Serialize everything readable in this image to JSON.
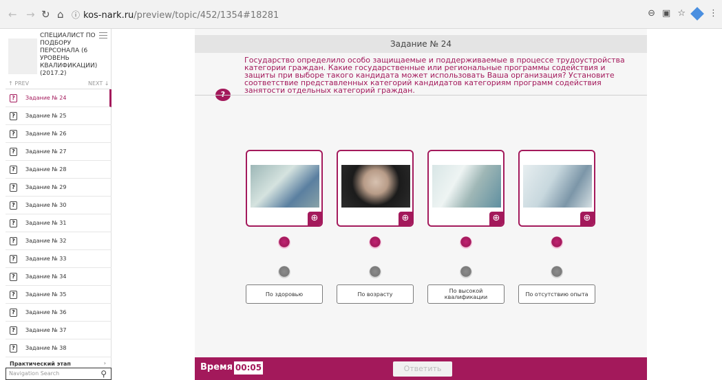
{
  "browser": {
    "url_host": "kos-nark.ru",
    "url_path": "/preview/topic/452/1354#18281"
  },
  "sidebar": {
    "course_title": "СПЕЦИАЛИСТ ПО ПОДБОРУ ПЕРСОНАЛА (6 УРОВЕНЬ КВАЛИФИКАЦИИ) (2017.2)",
    "prev_label": "↑ PREV",
    "next_label": "NEXT ↓",
    "items": [
      {
        "label": "Задание № 24"
      },
      {
        "label": "Задание № 25"
      },
      {
        "label": "Задание № 26"
      },
      {
        "label": "Задание № 27"
      },
      {
        "label": "Задание № 28"
      },
      {
        "label": "Задание № 29"
      },
      {
        "label": "Задание № 30"
      },
      {
        "label": "Задание № 31"
      },
      {
        "label": "Задание № 32"
      },
      {
        "label": "Задание № 33"
      },
      {
        "label": "Задание № 34"
      },
      {
        "label": "Задание № 35"
      },
      {
        "label": "Задание № 36"
      },
      {
        "label": "Задание № 37"
      },
      {
        "label": "Задание № 38"
      }
    ],
    "stage_label": "Практический этап",
    "search_placeholder": "Navigation Search"
  },
  "task": {
    "title": "Задание № 24",
    "question": "Государство определило особо защищаемые и поддерживаемые в процессе трудоустройства категории граждан. Какие государственные или региональные программы содействия и защиты при выборе такого кандидата может использовать Ваша организация? Установите соответствие представленных категорий кандидатов категориям программ содействия занятости отдельных категорий граждан.",
    "answers": [
      "По здоровью",
      "По возрасту",
      "По высокой квалификации",
      "По отсутствию опыта"
    ]
  },
  "footer": {
    "time_label": "Время",
    "time_value": "00:05",
    "submit_label": "Ответить"
  },
  "colors": {
    "accent": "#a3195b"
  }
}
